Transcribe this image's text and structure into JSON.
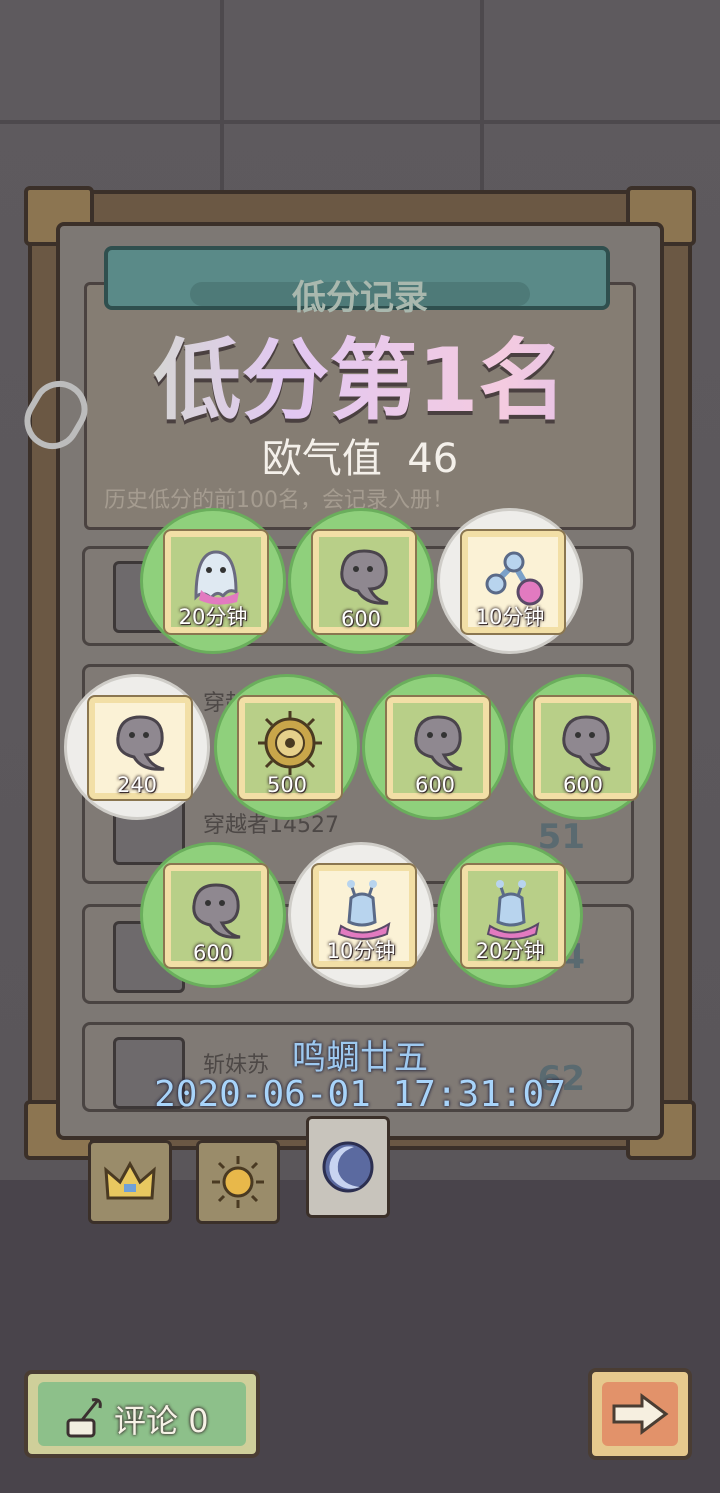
{
  "panel": {
    "banner_title": "低分记录",
    "headline": "低分第1名",
    "luck_label": "欧气值",
    "luck_value": "46",
    "subtitle": "历史低分的前100名，会记录入册！"
  },
  "rows": [
    {
      "name": "穿越者",
      "score": ""
    },
    {
      "name": "穿越者14527",
      "score": "51"
    },
    {
      "name": "",
      "score": "54"
    },
    {
      "name": "斩妹苏",
      "score": "62"
    }
  ],
  "rewards": [
    {
      "icon": "ghost-icon",
      "label": "20分钟",
      "style": "green"
    },
    {
      "icon": "clover-leaf-icon",
      "label": "600",
      "style": "green"
    },
    {
      "icon": "potion-flask-icon",
      "label": "10分钟",
      "style": "white"
    },
    {
      "icon": "clover-leaf-icon",
      "label": "240",
      "style": "white"
    },
    {
      "icon": "ornate-compass-icon",
      "label": "500",
      "style": "green"
    },
    {
      "icon": "clover-leaf-icon",
      "label": "600",
      "style": "green"
    },
    {
      "icon": "clover-leaf-icon",
      "label": "600",
      "style": "green"
    },
    {
      "icon": "clover-leaf-icon",
      "label": "600",
      "style": "green"
    },
    {
      "icon": "snail-icon",
      "label": "10分钟",
      "style": "white"
    },
    {
      "icon": "snail-icon",
      "label": "20分钟",
      "style": "green"
    }
  ],
  "sender": "鸣蜩廿五",
  "datetime": "2020-06-01  17:31:07",
  "tabs": [
    {
      "icon": "crown-icon",
      "active": false
    },
    {
      "icon": "sun-icon",
      "active": false
    },
    {
      "icon": "moon-icon",
      "active": true
    }
  ],
  "comment_button": {
    "label": "评论",
    "count": "0"
  },
  "next_button": {
    "icon": "arrow-right-icon"
  },
  "colors": {
    "reward_green": "#8fd07c",
    "reward_white": "#eeedea",
    "date_blue": "#a8d4fa"
  }
}
